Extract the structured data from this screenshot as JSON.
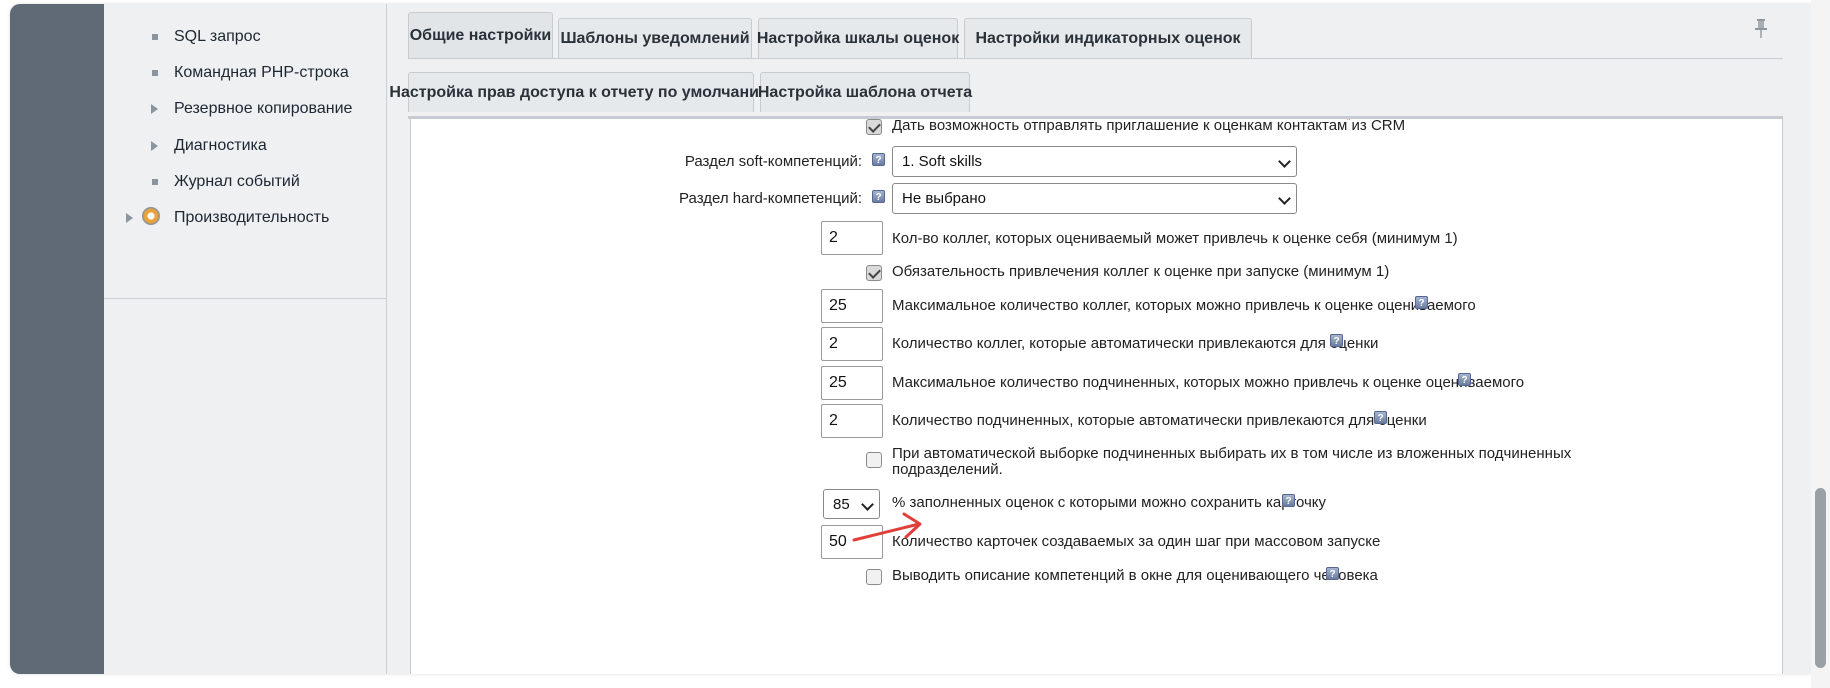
{
  "sidebar": {
    "items": [
      {
        "label": "SQL запрос",
        "marker": "bullet"
      },
      {
        "label": "Командная PHP-строка",
        "marker": "bullet"
      },
      {
        "label": "Резервное копирование",
        "marker": "expand-arrow"
      },
      {
        "label": "Диагностика",
        "marker": "expand-arrow"
      },
      {
        "label": "Журнал событий",
        "marker": "bullet"
      },
      {
        "label": "Производительность",
        "marker": "expand-arrow",
        "icon": "gauge-icon"
      }
    ]
  },
  "tabs": {
    "row1": [
      {
        "label": "Общие настройки",
        "active": true
      },
      {
        "label": "Шаблоны уведомлений",
        "active": false
      },
      {
        "label": "Настройка шкалы оценок",
        "active": false
      },
      {
        "label": "Настройки индикаторных оценок",
        "active": false
      }
    ],
    "row2": [
      {
        "label": "Настройка прав доступа к отчету по умолчанию",
        "active": false
      },
      {
        "label": "Настройка шаблона отчета",
        "active": false
      }
    ],
    "pin_icon": "pin-icon"
  },
  "form": {
    "crm_invite": {
      "label": "Дать возможность отправлять приглашение к оценкам контактам из CRM",
      "checked": true,
      "required_mark": "*"
    },
    "soft_section": {
      "label": "Раздел soft-компетенций:",
      "value": "1. Soft skills"
    },
    "hard_section": {
      "label": "Раздел hard-компетенций:",
      "value": "Не выбрано"
    },
    "colleagues_self": {
      "value": "2",
      "label": "Кол-во коллег, которых оцениваемый может привлечь к оценке себя (минимум 1)"
    },
    "colleagues_required": {
      "label": "Обязательность привлечения коллег к оценке при запуске (минимум 1)",
      "checked": true
    },
    "max_colleagues": {
      "value": "25",
      "label": "Максимальное количество коллег, которых можно привлечь к оценке оцениваемого"
    },
    "auto_colleagues": {
      "value": "2",
      "label": "Количество коллег, которые автоматически привлекаются для оценки"
    },
    "max_subordinates": {
      "value": "25",
      "label": "Максимальное количество подчиненных, которых можно привлечь к оценке оцениваемого"
    },
    "auto_subordinates": {
      "value": "2",
      "label": "Количество подчиненных, которые автоматически привлекаются для оценки"
    },
    "nested_subordinates": {
      "label_line1": "При автоматической выборке подчиненных выбирать их в том числе из вложенных подчиненных",
      "label_line2": "подразделений.",
      "checked": false
    },
    "fill_percent": {
      "value": "85",
      "label": "% заполненных оценок с которыми можно сохранить карточку"
    },
    "cards_per_step": {
      "value": "50",
      "label": "Количество карточек создаваемых за один шаг при массовом запуске"
    },
    "show_descriptions": {
      "label": "Выводить описание компетенций в окне для оценивающего человека",
      "checked": false
    }
  },
  "help_glyph": "?",
  "annotation": {
    "icon": "red-arrow-icon",
    "color": "#e0403a"
  },
  "colors": {
    "sidebar_dark": "#5f6a76",
    "panel_bg": "#eef0f2",
    "help_icon": "#7b8bb0"
  }
}
